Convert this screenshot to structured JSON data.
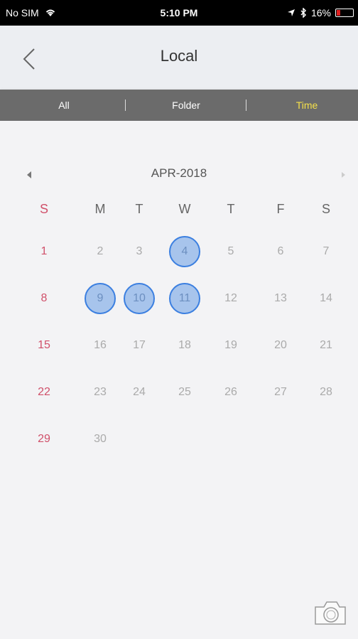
{
  "status": {
    "carrier": "No SIM",
    "time": "5:10 PM",
    "battery": "16%"
  },
  "nav": {
    "title": "Local"
  },
  "tabs": [
    {
      "label": "All",
      "active": false
    },
    {
      "label": "Folder",
      "active": false
    },
    {
      "label": "Time",
      "active": true
    }
  ],
  "calendar": {
    "month": "APR-2018",
    "weekdays": [
      "S",
      "M",
      "T",
      "W",
      "T",
      "F",
      "S"
    ],
    "weeks": [
      [
        "1",
        "2",
        "3",
        "4",
        "5",
        "6",
        "7"
      ],
      [
        "8",
        "9",
        "10",
        "11",
        "12",
        "13",
        "14"
      ],
      [
        "15",
        "16",
        "17",
        "18",
        "19",
        "20",
        "21"
      ],
      [
        "22",
        "23",
        "24",
        "25",
        "26",
        "27",
        "28"
      ],
      [
        "29",
        "30",
        "",
        "",
        "",
        "",
        ""
      ]
    ],
    "marked_days": [
      "4",
      "9",
      "10",
      "11"
    ]
  },
  "colors": {
    "accent_tab": "#f5e04a",
    "sunday": "#d0506a",
    "marked_fill": "#a7c4ec",
    "marked_ring": "#3b7fe0"
  },
  "icons": [
    "wifi-icon",
    "location-icon",
    "bluetooth-icon",
    "back-icon",
    "camera-icon"
  ]
}
